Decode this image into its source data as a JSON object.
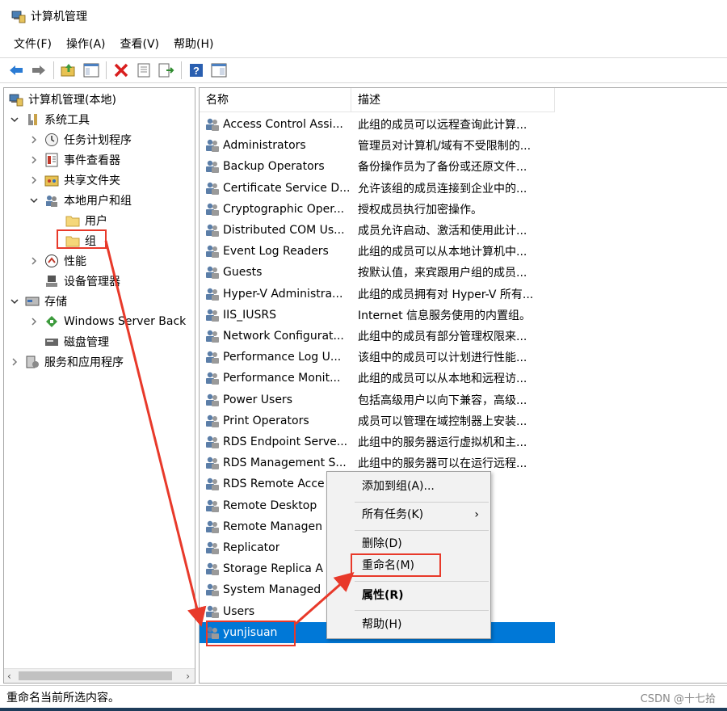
{
  "window": {
    "title": "计算机管理"
  },
  "menu": [
    "文件(F)",
    "操作(A)",
    "查看(V)",
    "帮助(H)"
  ],
  "toolbar": [
    "back-icon",
    "forward-icon",
    "up-folder-icon",
    "show-hide-tree-icon",
    "delete-icon",
    "properties-icon",
    "export-list-icon",
    "help-icon",
    "view-icon"
  ],
  "tree": [
    {
      "label": "计算机管理(本地)",
      "icon": "computer-management-icon",
      "expand": ""
    },
    {
      "label": "系统工具",
      "icon": "tools-icon",
      "expand": "open"
    },
    {
      "label": "任务计划程序",
      "icon": "clock-icon",
      "expand": "closed"
    },
    {
      "label": "事件查看器",
      "icon": "event-viewer-icon",
      "expand": "closed"
    },
    {
      "label": "共享文件夹",
      "icon": "shared-folder-icon",
      "expand": "closed"
    },
    {
      "label": "本地用户和组",
      "icon": "users-icon",
      "expand": "open"
    },
    {
      "label": "用户",
      "icon": "folder-icon",
      "expand": ""
    },
    {
      "label": "组",
      "icon": "folder-icon",
      "expand": ""
    },
    {
      "label": "性能",
      "icon": "performance-icon",
      "expand": "closed"
    },
    {
      "label": "设备管理器",
      "icon": "device-manager-icon",
      "expand": ""
    },
    {
      "label": "存储",
      "icon": "storage-icon",
      "expand": "open"
    },
    {
      "label": "Windows Server Back",
      "icon": "backup-icon",
      "expand": "closed"
    },
    {
      "label": "磁盘管理",
      "icon": "disk-icon",
      "expand": ""
    },
    {
      "label": "服务和应用程序",
      "icon": "services-icon",
      "expand": "closed"
    }
  ],
  "list": {
    "columns": [
      "名称",
      "描述"
    ],
    "rows": [
      {
        "name": "Access Control Assi...",
        "desc": "此组的成员可以远程查询此计算..."
      },
      {
        "name": "Administrators",
        "desc": "管理员对计算机/域有不受限制的..."
      },
      {
        "name": "Backup Operators",
        "desc": "备份操作员为了备份或还原文件..."
      },
      {
        "name": "Certificate Service D...",
        "desc": "允许该组的成员连接到企业中的..."
      },
      {
        "name": "Cryptographic Oper...",
        "desc": "授权成员执行加密操作。"
      },
      {
        "name": "Distributed COM Us...",
        "desc": "成员允许启动、激活和使用此计..."
      },
      {
        "name": "Event Log Readers",
        "desc": "此组的成员可以从本地计算机中..."
      },
      {
        "name": "Guests",
        "desc": "按默认值，来宾跟用户组的成员..."
      },
      {
        "name": "Hyper-V Administra...",
        "desc": "此组的成员拥有对 Hyper-V 所有..."
      },
      {
        "name": "IIS_IUSRS",
        "desc": "Internet 信息服务使用的内置组。"
      },
      {
        "name": "Network Configurat...",
        "desc": "此组中的成员有部分管理权限来..."
      },
      {
        "name": "Performance Log U...",
        "desc": "该组中的成员可以计划进行性能..."
      },
      {
        "name": "Performance Monit...",
        "desc": "此组的成员可以从本地和远程访..."
      },
      {
        "name": "Power Users",
        "desc": "包括高级用户以向下兼容，高级..."
      },
      {
        "name": "Print Operators",
        "desc": "成员可以管理在域控制器上安装..."
      },
      {
        "name": "RDS Endpoint Serve...",
        "desc": "此组中的服务器运行虚拟机和主..."
      },
      {
        "name": "RDS Management S...",
        "desc": "此组中的服务器可以在运行远程..."
      },
      {
        "name": "RDS Remote Acce",
        "desc": "oteApp ..."
      },
      {
        "name": "Remote Desktop",
        "desc": "登录的..."
      },
      {
        "name": "Remote Managen",
        "desc": "协议(例..."
      },
      {
        "name": "Replicator",
        "desc": ""
      },
      {
        "name": "Storage Replica A",
        "desc": "所有功..."
      },
      {
        "name": "System Managed",
        "desc": ""
      },
      {
        "name": "Users",
        "desc": "的系统..."
      },
      {
        "name": "yunjisuan",
        "desc": ""
      }
    ]
  },
  "context_menu": {
    "add_to_group": "添加到组(A)...",
    "all_tasks": "所有任务(K)",
    "all_tasks_arrow": "›",
    "delete": "删除(D)",
    "rename": "重命名(M)",
    "properties": "属性(R)",
    "help": "帮助(H)"
  },
  "status": {
    "text": "重命名当前所选内容。"
  },
  "watermark": "CSDN @十七拾",
  "colors": {
    "selection": "#0078d7",
    "annotation": "#e8392a"
  }
}
